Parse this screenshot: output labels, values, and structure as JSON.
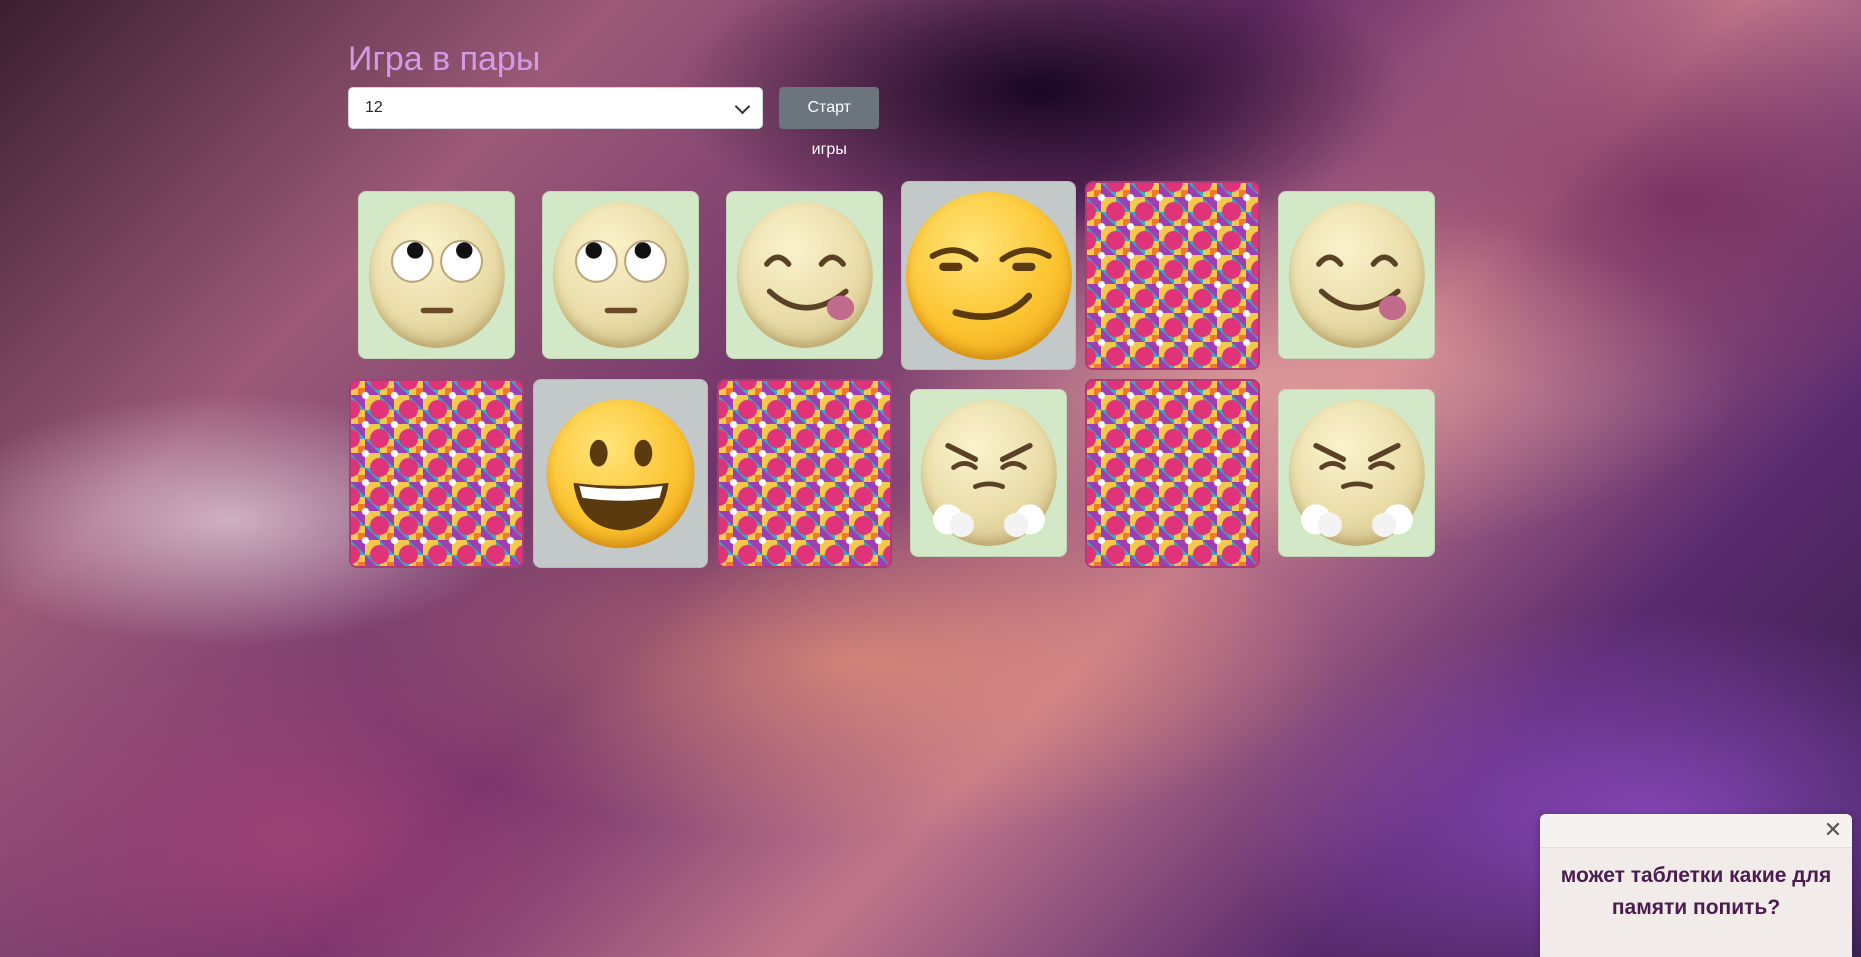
{
  "game": {
    "title": "Игра в пары",
    "select_value": "12",
    "start_button": "Старт игры"
  },
  "cards": [
    {
      "emoji": "eye-roll",
      "state": "open"
    },
    {
      "emoji": "eye-roll",
      "state": "open"
    },
    {
      "emoji": "yum",
      "state": "open"
    },
    {
      "emoji": "smirk",
      "state": "matched"
    },
    {
      "emoji": "",
      "state": "back"
    },
    {
      "emoji": "yum",
      "state": "open"
    },
    {
      "emoji": "",
      "state": "back"
    },
    {
      "emoji": "grin",
      "state": "matched"
    },
    {
      "emoji": "",
      "state": "back"
    },
    {
      "emoji": "steam",
      "state": "open"
    },
    {
      "emoji": "",
      "state": "back"
    },
    {
      "emoji": "steam",
      "state": "open"
    }
  ],
  "toast": {
    "message": "может таблетки какие для памяти попить?",
    "close_icon": "close-icon"
  }
}
